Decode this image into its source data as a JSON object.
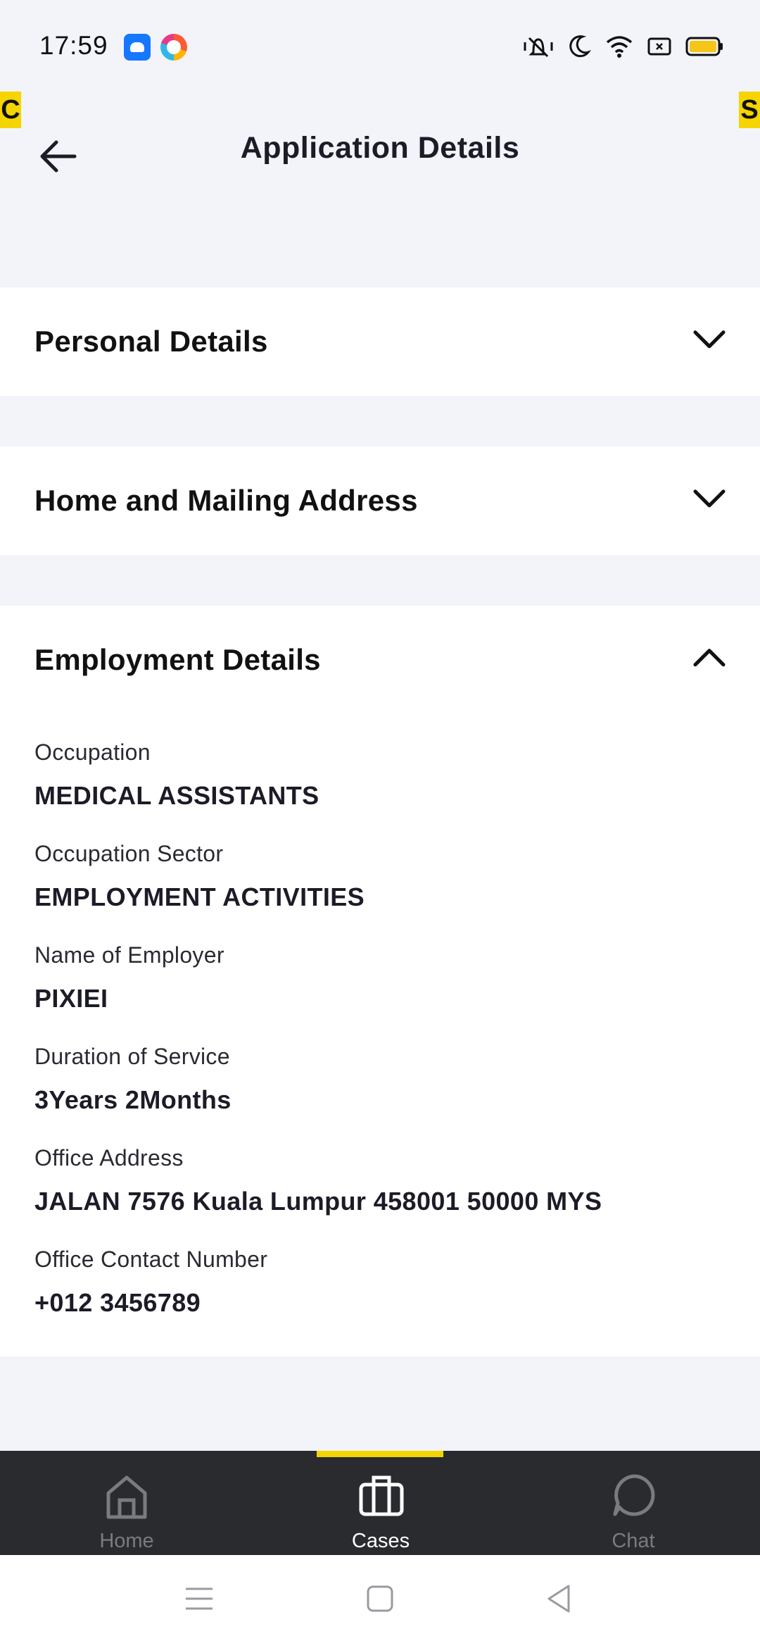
{
  "status_bar": {
    "time": "17:59",
    "notification_icons": [
      "app-notification-icon",
      "browser-notification-icon"
    ],
    "system_icons": [
      "vibrate-icon",
      "do-not-disturb-icon",
      "wifi-icon",
      "screen-icon",
      "battery-icon"
    ]
  },
  "edge_badges": {
    "left": "C",
    "right": "S",
    "color": "#f5d400"
  },
  "header": {
    "title": "Application Details"
  },
  "sections": {
    "personal": {
      "title": "Personal Details",
      "expanded": false
    },
    "address": {
      "title": "Home and Mailing Address",
      "expanded": false
    },
    "employment": {
      "title": "Employment Details",
      "expanded": true,
      "fields": [
        {
          "label": "Occupation",
          "value": "MEDICAL ASSISTANTS"
        },
        {
          "label": "Occupation Sector",
          "value": "EMPLOYMENT ACTIVITIES"
        },
        {
          "label": "Name of Employer",
          "value": "PIXIEI"
        },
        {
          "label": "Duration of Service",
          "value": "3Years 2Months"
        },
        {
          "label": "Office Address",
          "value": "JALAN 7576 Kuala Lumpur 458001 50000 MYS"
        },
        {
          "label": "Office Contact Number",
          "value": "+012 3456789"
        }
      ]
    }
  },
  "bottom_nav": {
    "items": [
      {
        "label": "Home",
        "icon": "home-icon",
        "active": false
      },
      {
        "label": "Cases",
        "icon": "briefcase-icon",
        "active": true
      },
      {
        "label": "Chat",
        "icon": "chat-icon",
        "active": false
      }
    ],
    "accent": "#f5d400",
    "background": "#2a2b2e"
  },
  "system_nav": {
    "buttons": [
      "menu-icon",
      "home-square-icon",
      "back-triangle-icon"
    ]
  }
}
